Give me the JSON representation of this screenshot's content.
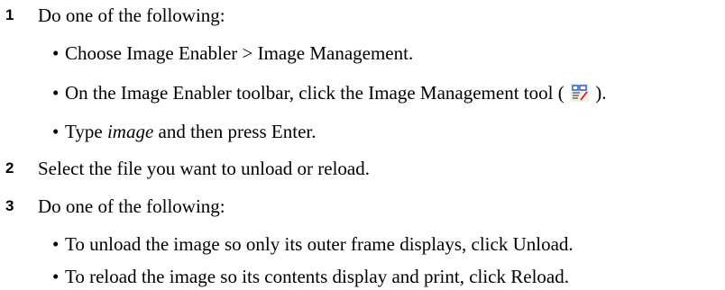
{
  "steps": [
    {
      "number": "1",
      "text": "Do one of the following:",
      "bullets": [
        {
          "text": "Choose Image Enabler > Image Management."
        },
        {
          "pre": "On the Image Enabler toolbar, click the Image Management tool (",
          "icon": "image-management-tool-icon",
          "post": ")."
        },
        {
          "pre": "Type ",
          "italic": "image",
          "post": " and then press Enter."
        }
      ]
    },
    {
      "number": "2",
      "text": "Select the file you want to unload or reload."
    },
    {
      "number": "3",
      "text": "Do one of the following:",
      "bullets": [
        {
          "text": "To unload the image so only its outer frame displays, click Unload."
        },
        {
          "text": "To reload the image so its contents display and print, click Reload."
        }
      ]
    }
  ],
  "bullet_glyph": "•"
}
